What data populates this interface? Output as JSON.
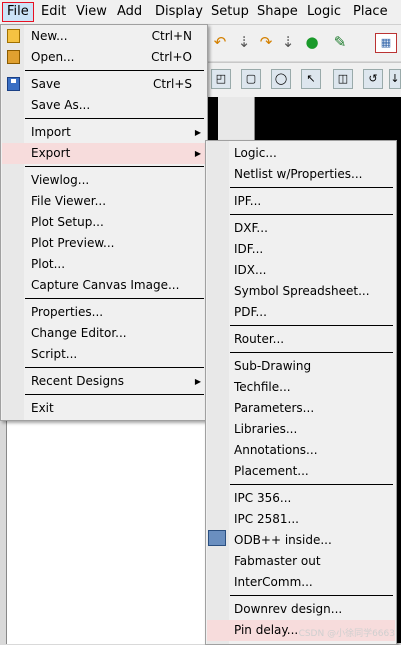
{
  "menubar": {
    "items": [
      "File",
      "Edit",
      "View",
      "Add",
      "Display",
      "Setup",
      "Shape",
      "Logic",
      "Place"
    ]
  },
  "toolbar_row1_icons": [
    "undo-icon",
    "redo-icon",
    "down-arrow-icon",
    "green-sphere-icon",
    "pin-icon",
    "grid-icon"
  ],
  "toolbar_row2_icons": [
    "rectangle-icon",
    "square-icon",
    "circle-icon",
    "select-arrow-icon",
    "shape-icon",
    "rotate-icon",
    "arrow-icon"
  ],
  "file_menu": {
    "items": [
      {
        "label": "New...",
        "shortcut": "Ctrl+N"
      },
      {
        "label": "Open...",
        "shortcut": "Ctrl+O"
      },
      {
        "label": "Save",
        "shortcut": "Ctrl+S"
      },
      {
        "label": "Save As..."
      },
      {
        "label": "Import"
      },
      {
        "label": "Export"
      },
      {
        "label": "Viewlog..."
      },
      {
        "label": "File Viewer..."
      },
      {
        "label": "Plot Setup..."
      },
      {
        "label": "Plot Preview..."
      },
      {
        "label": "Plot..."
      },
      {
        "label": "Capture Canvas Image..."
      },
      {
        "label": "Properties..."
      },
      {
        "label": "Change Editor..."
      },
      {
        "label": "Script..."
      },
      {
        "label": "Recent Designs"
      },
      {
        "label": "Exit"
      }
    ]
  },
  "export_menu": {
    "items": [
      "Logic...",
      "Netlist w/Properties...",
      "IPF...",
      "DXF...",
      "IDF...",
      "IDX...",
      "Symbol Spreadsheet...",
      "PDF...",
      "Router...",
      "Sub-Drawing",
      "Techfile...",
      "Parameters...",
      "Libraries...",
      "Annotations...",
      "Placement...",
      "IPC 356...",
      "IPC 2581...",
      "ODB++ inside...",
      "Fabmaster out",
      "InterComm...",
      "Downrev design...",
      "Pin delay..."
    ]
  },
  "watermark": "CSDN @小徐同学6663",
  "colors": {
    "highlight": "#f7dcdc",
    "active_border": "#e81123",
    "menu_bg": "#f0f0f0"
  }
}
